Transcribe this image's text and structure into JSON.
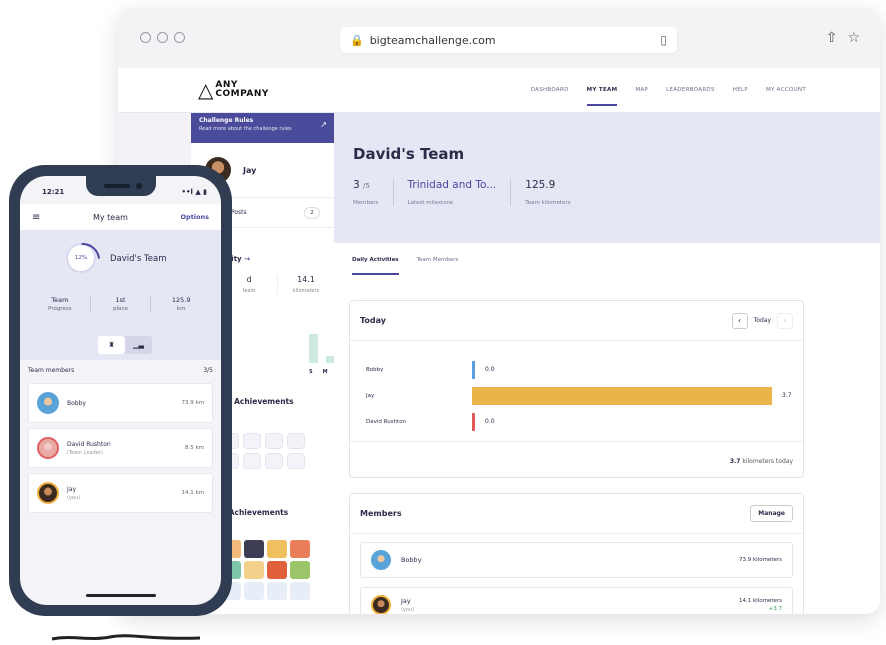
{
  "browser": {
    "url": "bigteamchallenge.com"
  },
  "site": {
    "logo_line1": "ANY",
    "logo_line2": "COMPANY",
    "nav": [
      "DASHBOARD",
      "MY TEAM",
      "MAP",
      "LEADERBOARDS",
      "HELP",
      "MY ACCOUNT"
    ],
    "nav_active": "MY TEAM"
  },
  "left": {
    "rules_title": "Challenge Rules",
    "rules_sub": "Read more about the challenge rules",
    "profile_name": "Jay",
    "news_label": "ws Posts",
    "news_count": "2",
    "activity_label": "tivity",
    "stat_value": "14.1",
    "stat_label1": "team",
    "stat_label2": "kilometers",
    "stat_d": "d",
    "days": [
      "S",
      "M",
      "T",
      "W",
      "T"
    ],
    "bar_levels": [
      0.85,
      0.2,
      0.2,
      0.85,
      0.35,
      0.35,
      1.0
    ],
    "ach1": "ge Achievements",
    "ach2": "e Achievements"
  },
  "team": {
    "title": "David's Team",
    "members_value": "3",
    "members_total": "/5",
    "members_label": "Members",
    "milestone_value": "Trinidad and To...",
    "milestone_label": "Latest milestone",
    "km_value": "125.9",
    "km_label": "Team kilometers"
  },
  "tabs": [
    "Daily Activities",
    "Team Members"
  ],
  "today": {
    "title": "Today",
    "nav_label": "Today",
    "max": 3.7,
    "rows": [
      {
        "name": "Bobby",
        "value": 0.0,
        "label": "0.0",
        "color": "#5c9ee0"
      },
      {
        "name": "Jay",
        "value": 3.7,
        "label": "3.7",
        "color": "#e9b54a"
      },
      {
        "name": "David Rushton",
        "value": 0.0,
        "label": "0.0",
        "color": "#e05a5a"
      }
    ],
    "total_value": "3.7",
    "total_label": "kilometers today"
  },
  "members": {
    "title": "Members",
    "manage_label": "Manage",
    "rows": [
      {
        "name": "Bobby",
        "sub": "",
        "km": "73.9 kilometers",
        "plus": ""
      },
      {
        "name": "Jay",
        "sub": "(you)",
        "km": "14.1 kilometers",
        "plus": "+3.7"
      }
    ]
  },
  "phone": {
    "time": "12:21",
    "signal": "••l ▲ ▮",
    "menu_icon": "≡",
    "title": "My team",
    "options": "Options",
    "progress_pct": "12%",
    "team_name": "David's Team",
    "stats": [
      {
        "value": "Team",
        "label": "Progress"
      },
      {
        "value": "1st",
        "label": "place"
      },
      {
        "value": "125.9",
        "label": "km"
      }
    ],
    "members_header": "Team members",
    "members_count": "3/5",
    "members": [
      {
        "name": "Bobby",
        "sub": "",
        "km": "73.9 km"
      },
      {
        "name": "David Rushton",
        "sub": "(Team Leader)",
        "km": "8.5 km"
      },
      {
        "name": "Jay",
        "sub": "(you)",
        "km": "14.1 km"
      }
    ]
  },
  "colors": {
    "accent": "#4a46a0",
    "band": "#e6e7f5",
    "phone_frame": "#2f3c52",
    "bar_jay": "#e9b54a",
    "bar_bobby": "#5c9ee0",
    "bar_david": "#e05a5a",
    "activity_high": "#3d8f73"
  }
}
